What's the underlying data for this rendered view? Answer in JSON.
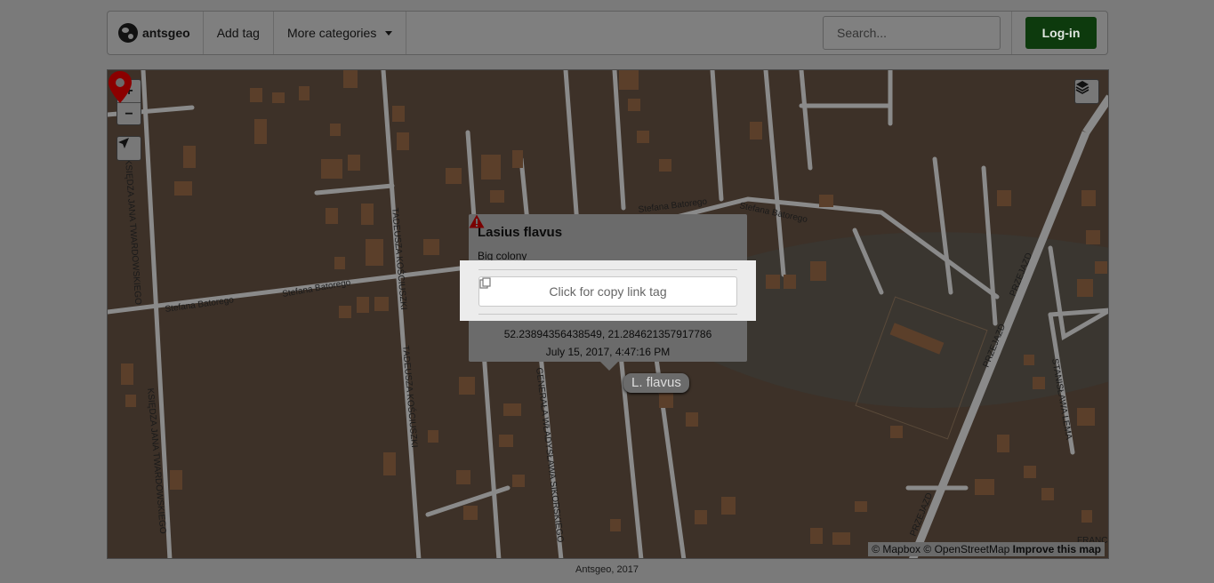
{
  "navbar": {
    "brand": "antsgeo",
    "add_tag": "Add tag",
    "more_categories": "More categories",
    "search_placeholder": "Search...",
    "login": "Log-in"
  },
  "map": {
    "zoom_in": "+",
    "zoom_out": "−",
    "street_labels": [
      "KSIĘDZA JANA TWARDOWSKIEGO",
      "Stefana Batorego",
      "TADEUSZA KOŚCIUSZKI",
      "GENERAŁA WŁADYSŁAWA SIKORSKIEGO",
      "PRZEJAZD",
      "STANISŁAWA LEMA",
      "FRANC"
    ],
    "attribution": {
      "mapbox": "© Mapbox",
      "osm": "© OpenStreetMap",
      "improve": "Improve this map"
    }
  },
  "popup": {
    "title": "Lasius flavus",
    "description": "Big colony",
    "copy_button": "Click for copy link tag",
    "coordinates": "52.23894356438549, 21.284621357917786",
    "date": "July 15, 2017, 4:47:16 PM"
  },
  "marker": {
    "label": "L. flavus",
    "color": "#8b0000"
  },
  "footer": {
    "text": "Antsgeo, 2017"
  }
}
